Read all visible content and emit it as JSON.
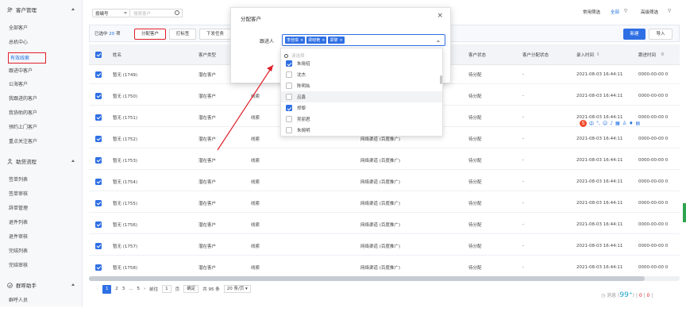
{
  "sidebar": {
    "groups": [
      {
        "title": "客户管理",
        "items": [
          "全部客户",
          "总机中心",
          "有效线索",
          "跟进中客户",
          "公海客户",
          "我跟进的客户",
          "我协助的客户",
          "预约上门客户",
          "重点关注客户"
        ]
      },
      {
        "title": "助贷流程",
        "items": [
          "签单列表",
          "签单审核",
          "辞单管理",
          "退件列表",
          "退件审核",
          "完结列表",
          "完结审核"
        ]
      },
      {
        "title": "群呼助手",
        "items": [
          "群呼人员"
        ]
      }
    ],
    "active_item": "有效线索"
  },
  "search": {
    "field_select": "按编号",
    "placeholder": "搜索客户"
  },
  "top_filters": {
    "common_filter": "常用筛选",
    "all": "全部",
    "advanced_filter": "高级筛选"
  },
  "toolbar": {
    "selected_prefix": "已选中",
    "selected_count": "20",
    "selected_suffix": "项",
    "buttons": [
      "分配客户",
      "打标签",
      "下发任务"
    ],
    "new_label": "新建",
    "import_label": "导入"
  },
  "table": {
    "columns": [
      "姓名",
      "客户类型",
      "",
      "",
      "",
      "",
      "客户状态",
      "客户分配状态",
      "录入时间",
      "跟进时间"
    ],
    "rows": [
      {
        "name": "暂无 (1749)",
        "type": "潜在客户",
        "source": "",
        "channel": "",
        "status": "待分配",
        "assign": "-",
        "time": "2021-08-03 16:44:11",
        "follow": "0000-00-00 0"
      },
      {
        "name": "暂无 (1750)",
        "type": "潜在客户",
        "source": "线索",
        "channel": "",
        "status": "待分配",
        "assign": "-",
        "time": "2021-08-03 16:44:11",
        "follow": "0000-00-00 0"
      },
      {
        "name": "暂无 (1751)",
        "type": "潜在客户",
        "source": "线索",
        "channel": "",
        "status": "待分配",
        "assign": "-",
        "time": "2021-08-03 16:44:11",
        "follow": "0000-00-00 0"
      },
      {
        "name": "暂无 (1752)",
        "type": "潜在客户",
        "source": "线索",
        "channel": "网络渠道 (百度推广)",
        "status": "待分配",
        "assign": "-",
        "time": "2021-08-03 16:44:11",
        "follow": "0000-00-00 0"
      },
      {
        "name": "暂无 (1753)",
        "type": "潜在客户",
        "source": "线索",
        "channel": "网络渠道 (百度推广)",
        "status": "待分配",
        "assign": "-",
        "time": "2021-08-03 16:44:11",
        "follow": "0000-00-00 0"
      },
      {
        "name": "暂无 (1754)",
        "type": "潜在客户",
        "source": "线索",
        "channel": "网络渠道 (百度推广)",
        "status": "待分配",
        "assign": "-",
        "time": "2021-08-03 16:44:11",
        "follow": "0000-00-00 0"
      },
      {
        "name": "暂无 (1755)",
        "type": "潜在客户",
        "source": "线索",
        "channel": "网络渠道 (百度推广)",
        "status": "待分配",
        "assign": "-",
        "time": "2021-08-03 16:44:11",
        "follow": "0000-00-00 0"
      },
      {
        "name": "暂无 (1756)",
        "type": "潜在客户",
        "source": "线索",
        "channel": "网络渠道 (百度推广)",
        "status": "待分配",
        "assign": "-",
        "time": "2021-08-03 16:44:11",
        "follow": "0000-00-00 0"
      },
      {
        "name": "暂无 (1757)",
        "type": "潜在客户",
        "source": "线索",
        "channel": "网络渠道 (百度推广)",
        "status": "待分配",
        "assign": "-",
        "time": "2021-08-03 16:44:11",
        "follow": "0000-00-00 0"
      },
      {
        "name": "暂无 (1758)",
        "type": "潜在客户",
        "source": "线索",
        "channel": "网络渠道 (百度推广)",
        "status": "待分配",
        "assign": "-",
        "time": "2021-08-03 16:44:11",
        "follow": "0000-00-00 0"
      }
    ]
  },
  "pagination": {
    "pages": [
      "1",
      "2",
      "3",
      "...",
      "5"
    ],
    "goto_label": "前往",
    "goto_value": "1",
    "page_unit": "页",
    "confirm": "确定",
    "total": "共 95 条",
    "page_size": "20 条/页"
  },
  "message_bar": {
    "label": "消息 (",
    "count": "99⁺",
    "sep1": ")",
    "zero1": "0",
    "zero2": "0"
  },
  "modal": {
    "title": "分配客户",
    "close": "×",
    "field_label": "跟进人",
    "tags": [
      "李佳琪",
      "梁晓艳",
      "郑黎"
    ],
    "search_placeholder": "请选择",
    "options": [
      {
        "label": "朱晓绍",
        "checked": true
      },
      {
        "label": "沈杰",
        "checked": false
      },
      {
        "label": "陈明灿",
        "checked": false
      },
      {
        "label": "吕鑫",
        "checked": false
      },
      {
        "label": "郑黎",
        "checked": true
      },
      {
        "label": "吴丽君",
        "checked": false
      },
      {
        "label": "朱婉明",
        "checked": false
      }
    ]
  },
  "ime": {
    "label": "中"
  },
  "colors": {
    "accent": "#2f6fe4",
    "highlight": "#e0202b"
  }
}
